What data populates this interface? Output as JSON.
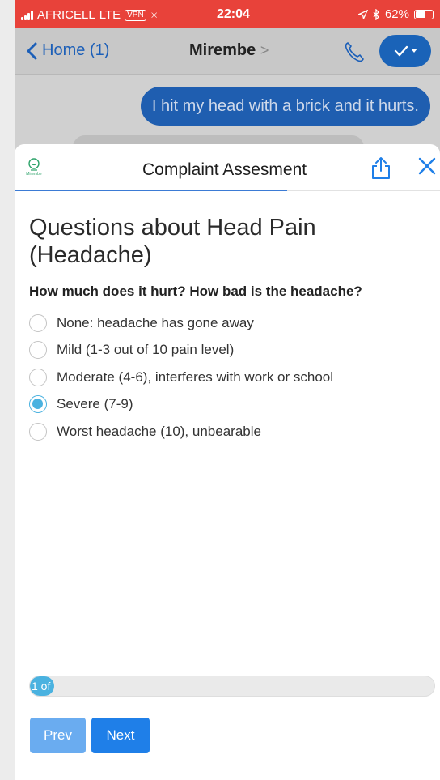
{
  "status_bar": {
    "carrier": "AFRICELL",
    "network": "LTE",
    "vpn": "VPN",
    "time": "22:04",
    "battery": "62%",
    "battery_level": 0.62
  },
  "nav": {
    "back_label": "Home (1)",
    "contact_name": "Mirembe",
    "title_chevron": ">",
    "icons": [
      "chevron-left-icon",
      "phone-icon",
      "check-icon"
    ]
  },
  "chat": {
    "outgoing_message": "I hit my head with a brick and it hurts."
  },
  "sheet": {
    "logo_text": "Mirembe",
    "title": "Complaint Assesment",
    "icons": [
      "share-icon",
      "close-icon"
    ]
  },
  "form": {
    "heading": "Questions about Head Pain (Headache)",
    "question": "How much does it hurt? How bad is the headache?",
    "options": [
      "None: headache has gone away",
      "Mild (1-3 out of 10 pain level)",
      "Moderate (4-6), interferes with work or school",
      "Severe (7-9)",
      "Worst headache (10), unbearable"
    ],
    "selected_option": "Severe (7-9)",
    "progress_label": "1 of",
    "progress_fraction": 0.06,
    "prev_label": "Prev",
    "next_label": "Next"
  },
  "colors": {
    "status_bar": "#e8423a",
    "accent": "#4ab2e0",
    "button_primary": "#1f7fe8",
    "button_disabled": "#6aacf0",
    "message_bubble": "#1f5eb0"
  }
}
